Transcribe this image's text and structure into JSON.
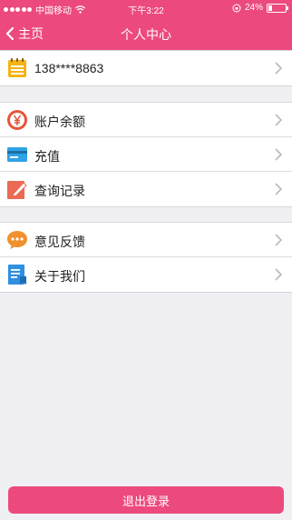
{
  "status_bar": {
    "carrier": "中国移动",
    "time": "下午3:22",
    "battery_text": "24%",
    "battery_level": 0.24
  },
  "nav": {
    "back_label": "主页",
    "title": "个人中心"
  },
  "account_row": {
    "phone": "138****8863"
  },
  "menu_group_1": [
    {
      "label": "账户余额",
      "icon": "yen-icon"
    },
    {
      "label": "充值",
      "icon": "credit-card-icon"
    },
    {
      "label": "查询记录",
      "icon": "pencil-icon"
    }
  ],
  "menu_group_2": [
    {
      "label": "意见反馈",
      "icon": "chat-bubble-icon"
    },
    {
      "label": "关于我们",
      "icon": "book-icon"
    }
  ],
  "logout": {
    "label": "退出登录"
  },
  "colors": {
    "brand": "#ec4a7c",
    "background": "#efeff4",
    "chevron": "#b9b9be"
  }
}
